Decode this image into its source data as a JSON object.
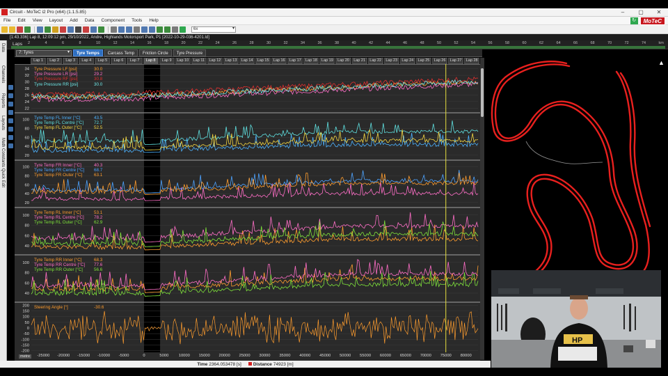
{
  "window": {
    "title": "Circuit - MoTeC i2 Pro (x64) (1.1.5.85)",
    "minimize": "–",
    "maximize": "▢",
    "close": "✕"
  },
  "menu": [
    "File",
    "Edit",
    "View",
    "Layout",
    "Add",
    "Data",
    "Component",
    "Tools",
    "Help"
  ],
  "brand": {
    "logo": "MoTeC",
    "go": "↻",
    "accent": "#c8161d"
  },
  "toolbar": {
    "zoom_value": "6x"
  },
  "infobar": {
    "text": "[1:43.336] Lap 8, 12:09:12 pm, 29/10/2022, Andre, Highlands Motorsport Park, P1 [2022-10-29-036-4201.ld]"
  },
  "laps_bar": {
    "label": "Laps",
    "ticks": [
      "2",
      "4",
      "6",
      "8",
      "10",
      "12",
      "14",
      "16",
      "18",
      "20",
      "22",
      "24",
      "26",
      "28",
      "30",
      "32",
      "34",
      "36",
      "38",
      "40",
      "42",
      "44",
      "46",
      "48",
      "50",
      "52",
      "54",
      "56",
      "58",
      "60",
      "62",
      "64",
      "66",
      "68",
      "70",
      "72",
      "74",
      "km"
    ]
  },
  "left_panel": {
    "tabs": [
      "Data",
      "Channels",
      "Reports",
      "Layouts",
      "Math Constants Quick Edit"
    ]
  },
  "worksheet": {
    "selector": "7: Tyres",
    "tabs": [
      {
        "label": "Tyre Temps",
        "active": true
      },
      {
        "label": "Carcass Temp",
        "active": false
      },
      {
        "label": "Friction Circle",
        "active": false
      },
      {
        "label": "Tyre Pressure",
        "active": false
      }
    ]
  },
  "laps": [
    "Lap 1",
    "Lap 2",
    "Lap 3",
    "Lap 4",
    "Lap 5",
    "Lap 6",
    "Lap 7",
    "Lap 8",
    "Lap 9",
    "Lap 10",
    "Lap 11",
    "Lap 12",
    "Lap 13",
    "Lap 14",
    "Lap 15",
    "Lap 16",
    "Lap 17",
    "Lap 18",
    "Lap 19",
    "Lap 20",
    "Lap 21",
    "Lap 22",
    "Lap 23",
    "Lap 24",
    "Lap 25",
    "Lap 26",
    "Lap 27",
    "Lap 28"
  ],
  "graphs": [
    {
      "id": "pressure",
      "y_ticks": [
        "34",
        "32",
        "30",
        "28",
        "26",
        "24",
        "22"
      ],
      "ylim": [
        21,
        35
      ],
      "legend": [
        {
          "name": "Tyre Pressure LF [psi]",
          "value": "30.0",
          "color": "#ff9d2e"
        },
        {
          "name": "Tyre Pressure LR [psi]",
          "value": "29.2",
          "color": "#ff6ec7"
        },
        {
          "name": "Tyre Pressure RF [psi]",
          "value": "30.8",
          "color": "#e03030"
        },
        {
          "name": "Tyre Pressure RR [psi]",
          "value": "30.0",
          "color": "#6fe6e6"
        }
      ]
    },
    {
      "id": "fl",
      "y_ticks": [
        "100",
        "80",
        "60",
        "40",
        "20"
      ],
      "ylim": [
        12,
        112
      ],
      "legend": [
        {
          "name": "Tyre Temp FL Inner [°C]",
          "value": "43.5",
          "color": "#4db3ff"
        },
        {
          "name": "Tyre Temp FL Centre [°C]",
          "value": "72.7",
          "color": "#5fe0e0"
        },
        {
          "name": "Tyre Temp FL Outer [°C]",
          "value": "52.5",
          "color": "#f5d742"
        }
      ]
    },
    {
      "id": "fr",
      "y_ticks": [
        "100",
        "80",
        "60",
        "40",
        "20"
      ],
      "ylim": [
        12,
        112
      ],
      "legend": [
        {
          "name": "Tyre Temp FR Inner [°C]",
          "value": "40.3",
          "color": "#ff6ec7"
        },
        {
          "name": "Tyre Temp FR Centre [°C]",
          "value": "68.7",
          "color": "#4da3ff"
        },
        {
          "name": "Tyre Temp FR Outer [°C]",
          "value": "63.1",
          "color": "#ff9d2e"
        }
      ]
    },
    {
      "id": "rl",
      "y_ticks": [
        "100",
        "80",
        "60",
        "40"
      ],
      "ylim": [
        25,
        112
      ],
      "legend": [
        {
          "name": "Tyre Temp RL Inner [°C]",
          "value": "53.1",
          "color": "#ff9d2e"
        },
        {
          "name": "Tyre Temp RL Centre [°C]",
          "value": "78.2",
          "color": "#ff6ec7"
        },
        {
          "name": "Tyre Temp RL Outer [°C]",
          "value": "62.9",
          "color": "#7fe33a"
        }
      ]
    },
    {
      "id": "rr",
      "y_ticks": [
        "100",
        "80",
        "60",
        "40"
      ],
      "ylim": [
        25,
        112
      ],
      "legend": [
        {
          "name": "Tyre Temp RR Inner [°C]",
          "value": "68.3",
          "color": "#ff9d2e"
        },
        {
          "name": "Tyre Temp RR Centre [°C]",
          "value": "77.6",
          "color": "#ff6ec7"
        },
        {
          "name": "Tyre Temp RR Outer [°C]",
          "value": "56.6",
          "color": "#7fe33a"
        }
      ]
    },
    {
      "id": "steer",
      "y_ticks": [
        "200",
        "150",
        "100",
        "50",
        "0",
        "-50",
        "-100",
        "-150",
        "-200"
      ],
      "ylim": [
        -215,
        215
      ],
      "legend": [
        {
          "name": "Steering Angle [°]",
          "value": "-30.6",
          "color": "#ff9d2e"
        }
      ]
    }
  ],
  "x_axis": {
    "unit": "metre",
    "ticks": [
      "-25000",
      "-20000",
      "-15000",
      "-10000",
      "-5000",
      "0",
      "5000",
      "10000",
      "15000",
      "20000",
      "25000",
      "30000",
      "35000",
      "40000",
      "45000",
      "50000",
      "55000",
      "60000",
      "65000",
      "70000",
      "75000",
      "80000"
    ],
    "range": [
      -28000,
      83000
    ],
    "cursor": 75000
  },
  "status": {
    "time_label": "Time",
    "time_value": "2364.053478 [s]",
    "distance_label": "Distance",
    "distance_value": "74923 [m]"
  }
}
